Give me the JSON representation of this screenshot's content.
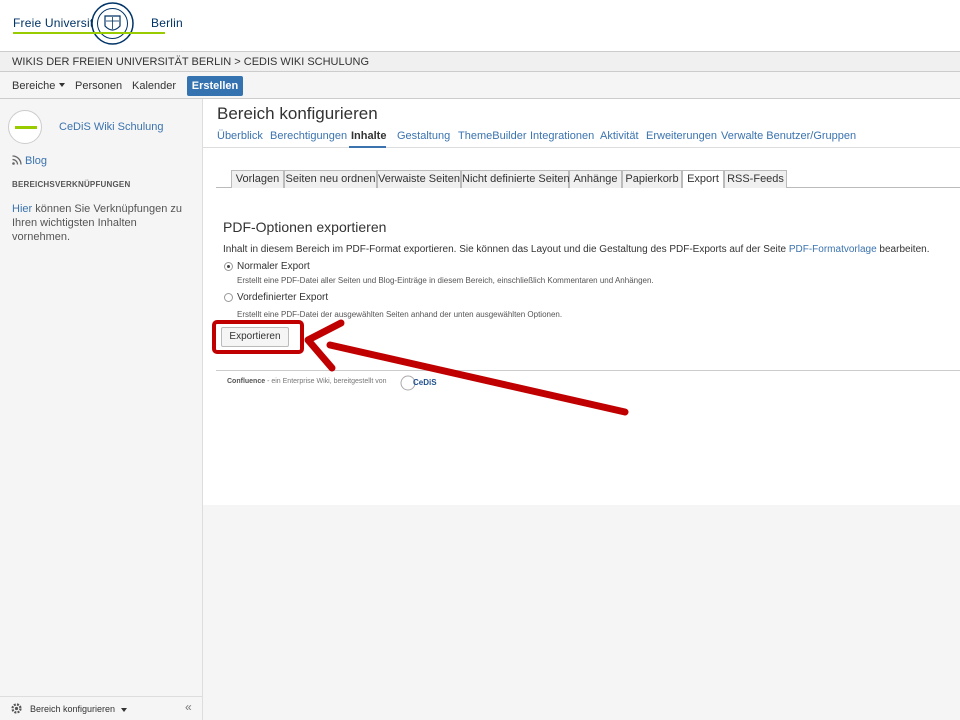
{
  "fu": {
    "logo_left": "Freie Universität",
    "logo_right": "Berlin",
    "breadcrumb": "WIKIS DER FREIEN UNIVERSITÄT BERLIN > CEDIS WIKI SCHULUNG"
  },
  "nav": {
    "spaces": "Bereiche",
    "people": "Personen",
    "calendar": "Kalender",
    "create": "Erstellen"
  },
  "sidebar": {
    "space_name": "CeDiS Wiki Schulung",
    "blog": "Blog",
    "shortcuts_heading": "BEREICHSVERKNÜPFUNGEN",
    "shortcuts_link": "Hier",
    "shortcuts_text": " können Sie Verknüpfungen zu Ihren wichtigsten Inhalten vornehmen.",
    "footer_label": "Bereich konfigurieren",
    "collapse": "«"
  },
  "main": {
    "title": "Bereich konfigurieren",
    "config_tabs": [
      "Überblick",
      "Berechtigungen",
      "Inhalte",
      "Gestaltung",
      "ThemeBuilder",
      "Integrationen",
      "Aktivität",
      "Erweiterungen",
      "Verwalte Benutzer/Gruppen"
    ],
    "active_config_tab": "Inhalte",
    "sub_tabs": [
      "Vorlagen",
      "Seiten neu ordnen",
      "Verwaiste Seiten",
      "Nicht definierte Seiten",
      "Anhänge",
      "Papierkorb",
      "Export",
      "RSS-Feeds"
    ],
    "active_sub_tab": "Export"
  },
  "pdf": {
    "title": "PDF-Optionen exportieren",
    "desc_prefix": "Inhalt in diesem Bereich im PDF-Format exportieren. Sie können das Layout und die Gestaltung des PDF-Exports auf der Seite ",
    "desc_link": "PDF-Formatvorlage",
    "desc_suffix": " bearbeiten.",
    "opt1_label": "Normaler Export",
    "opt1_desc": "Erstellt eine PDF-Datei aller Seiten und Blog-Einträge in diesem Bereich, einschließlich Kommentaren und Anhängen.",
    "opt2_label": "Vordefinierter Export",
    "opt2_desc": "Erstellt eine PDF-Datei der ausgewählten Seiten anhand der unten ausgewählten Optionen.",
    "selected_option": "Normaler Export",
    "export_button": "Exportieren"
  },
  "footer": {
    "brand": "Confluence",
    "text": " - ein Enterprise Wiki, bereitgestellt von",
    "cedis": "CeDiS"
  },
  "colors": {
    "accent": "#3b73af",
    "create_button": "#3572b0",
    "fu_green": "#99cc00",
    "highlight": "#c00000"
  }
}
